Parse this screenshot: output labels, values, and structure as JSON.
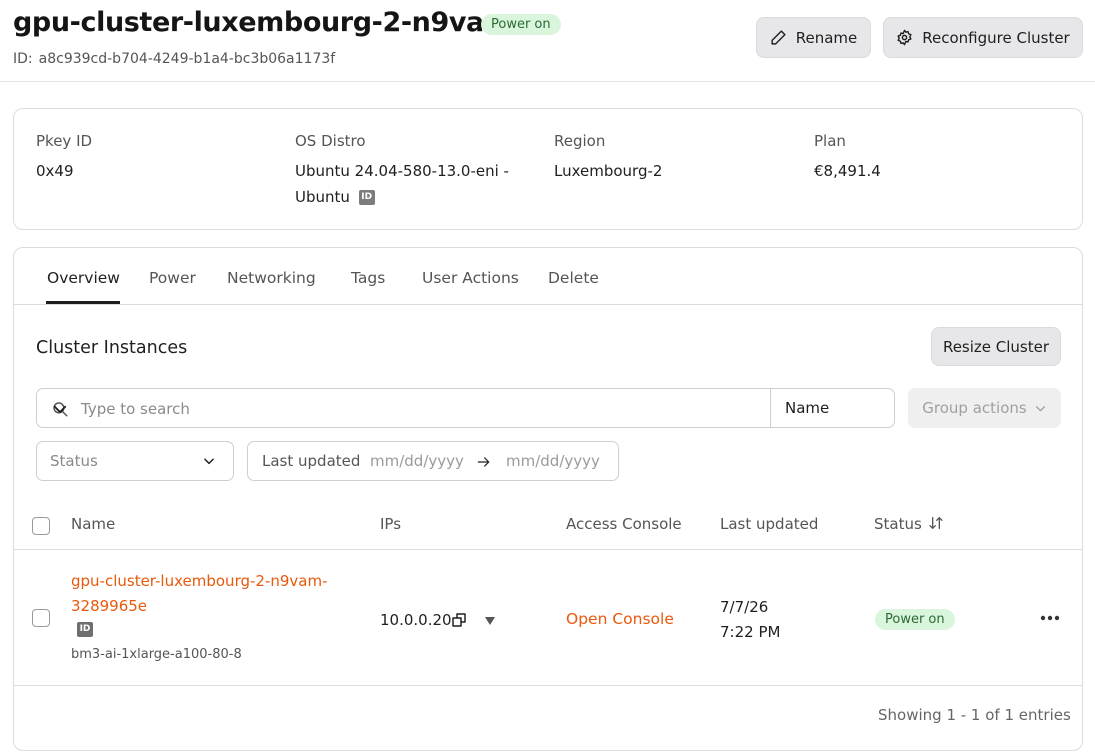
{
  "header": {
    "title": "gpu-cluster-luxembourg-2-n9vam",
    "status_badge": "Power on",
    "id_label": "ID:",
    "id_value": "a8c939cd-b704-4249-b1a4-bc3b06a1173f",
    "rename_label": "Rename",
    "reconfigure_label": "Reconfigure Cluster"
  },
  "info": {
    "pkey_label": "Pkey ID",
    "pkey_value": "0x49",
    "os_label": "OS Distro",
    "os_value_line1": "Ubuntu 24.04-580-13.0-eni -",
    "os_value_line2": "Ubuntu",
    "id_chip": "ID",
    "region_label": "Region",
    "region_value": "Luxembourg-2",
    "plan_label": "Plan",
    "plan_value": "€8,491.4"
  },
  "tabs": [
    "Overview",
    "Power",
    "Networking",
    "Tags",
    "User Actions",
    "Delete"
  ],
  "active_tab": "Overview",
  "instances": {
    "section_title": "Cluster Instances",
    "resize_label": "Resize Cluster",
    "search_placeholder": "Type to search",
    "search_field": "Name",
    "group_actions_label": "Group actions",
    "status_filter_placeholder": "Status",
    "date_filter_label": "Last updated",
    "date_from_placeholder": "mm/dd/yyyy",
    "date_to_placeholder": "mm/dd/yyyy",
    "columns": {
      "name": "Name",
      "ips": "IPs",
      "console": "Access Console",
      "updated": "Last updated",
      "status": "Status"
    },
    "rows": [
      {
        "name": "gpu-cluster-luxembourg-2-n9vam-3289965e",
        "id_chip": "ID",
        "plan": "bm3-ai-1xlarge-a100-80-8",
        "ip": "10.0.0.20",
        "console": "Open Console",
        "updated_date": "7/7/26",
        "updated_time": "7:22 PM",
        "status": "Power on"
      }
    ],
    "footer": "Showing 1 - 1 of 1 entries"
  },
  "colors": {
    "accent_orange": "#e8590c",
    "badge_green_bg": "#d9f5dc",
    "badge_green_text": "#2d6a35"
  }
}
